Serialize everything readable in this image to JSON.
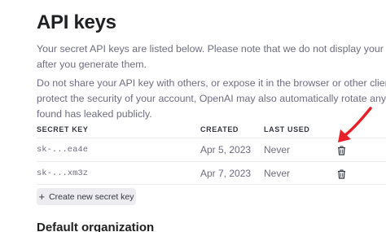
{
  "page": {
    "title": "API keys",
    "intro_lines": [
      "Your secret API keys are listed below. Please note that we do not display your secret API k",
      "after you generate them."
    ],
    "warning_lines": [
      "Do not share your API key with others, or expose it in the browser or other client-side code",
      "protect the security of your account, OpenAI may also automatically rotate any API key th",
      "found has leaked publicly."
    ]
  },
  "table": {
    "headers": {
      "secret_key": "SECRET KEY",
      "created": "CREATED",
      "last_used": "LAST USED"
    },
    "rows": [
      {
        "secret_key": "sk-...ea4e",
        "created": "Apr 5, 2023",
        "last_used": "Never",
        "action_icon": "trash-icon"
      },
      {
        "secret_key": "sk-...xm3z",
        "created": "Apr 7, 2023",
        "last_used": "Never",
        "action_icon": "trash-icon"
      }
    ]
  },
  "actions": {
    "create_label": "Create new secret key",
    "create_icon": "plus-icon"
  },
  "section": {
    "heading": "Default organization"
  },
  "annotation": {
    "arrow_color": "#e8202a"
  }
}
